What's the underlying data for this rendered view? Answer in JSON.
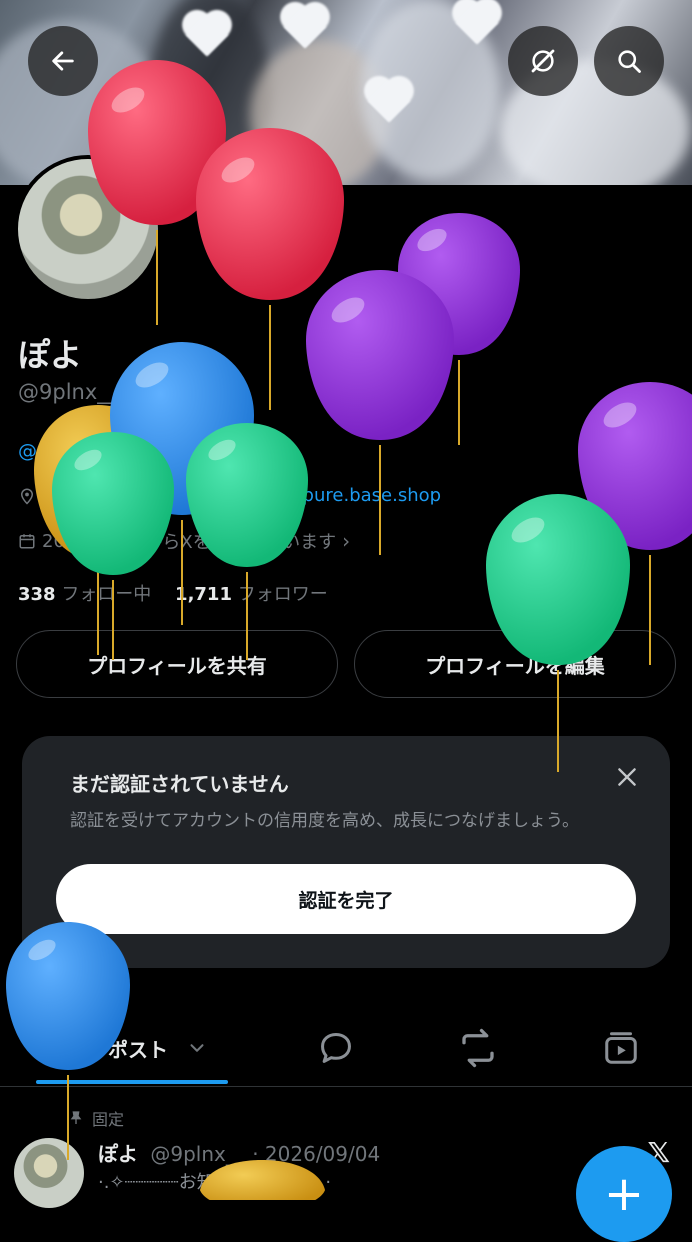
{
  "profile": {
    "name": "ぽよ",
    "handle": "@9plnx__",
    "bio_link": "@myutopure_cafe",
    "location": "s",
    "location_tail": "plnx_",
    "website": "myutopure.base.shop",
    "joined_prefix": "202",
    "joined_suffix": "月からXを利用しています",
    "following_count": "338",
    "following_label": "フォロー中",
    "followers_count": "1,711",
    "followers_label": "フォロワー"
  },
  "buttons": {
    "share_profile": "プロフィールを共有",
    "edit_profile": "プロフィールを編集"
  },
  "verify_card": {
    "title": "まだ認証されていません",
    "description": "認証を受けてアカウントの信用度を高め、成長につなげましょう。",
    "cta": "認証を完了"
  },
  "tabs": {
    "posts_label": "ポスト"
  },
  "pinned_post": {
    "pinned_label": "固定",
    "author": "ぽよ",
    "meta": "@9plnx__ · 2026/09/04",
    "body": "·.✧┈┈┈┈┈お知らせ┈┈┈┈┈✧.·"
  },
  "icons": {
    "back": "arrow-left-icon",
    "grok": "grok-icon",
    "search": "search-icon",
    "close": "close-icon",
    "compose": "plus-icon"
  },
  "colors": {
    "accent": "#1d9bf0",
    "background": "#000000",
    "card": "#202327",
    "balloon_red": "#e0334f",
    "balloon_purple": "#8a2fd0",
    "balloon_blue": "#2f8fe0",
    "balloon_green": "#22c98c",
    "balloon_yellow": "#d9a92a"
  }
}
